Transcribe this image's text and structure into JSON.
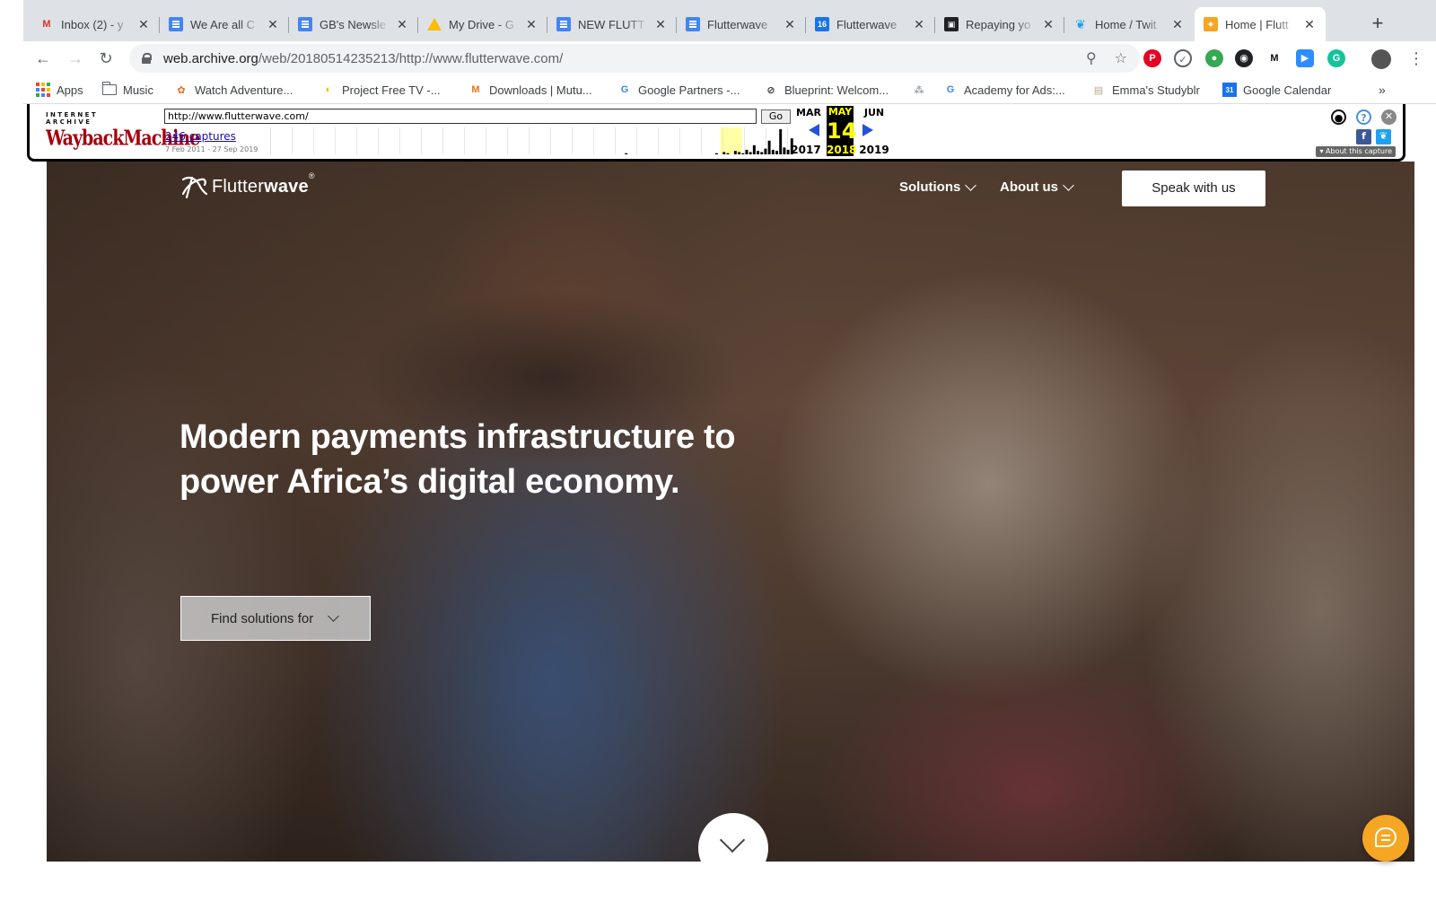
{
  "browser": {
    "tabs": [
      {
        "title": "Inbox (2) - y",
        "icon": "gmail-icon"
      },
      {
        "title": "We Are all C",
        "icon": "docs-icon"
      },
      {
        "title": "GB's Newsle",
        "icon": "docs-icon"
      },
      {
        "title": "My Drive - G",
        "icon": "drive-icon"
      },
      {
        "title": "NEW FLUTT",
        "icon": "docs-icon"
      },
      {
        "title": "Flutterwave",
        "icon": "docs-icon"
      },
      {
        "title": "Flutterwave",
        "icon": "calendar-icon",
        "icon_text": "16"
      },
      {
        "title": "Repaying yo",
        "icon": "page-icon"
      },
      {
        "title": "Home / Twit",
        "icon": "twitter-icon"
      },
      {
        "title": "Home | Flutt",
        "icon": "flutterwave-icon",
        "active": true
      }
    ],
    "url_host": "web.archive.org",
    "url_path": "/web/20180514235213/http://www.flutterwave.com/",
    "bookmarks": [
      "Apps",
      "Music",
      "Watch Adventure...",
      "Project Free TV -...",
      "Downloads | Mutu...",
      "Google Partners -...",
      "Blueprint: Welcom...",
      "Academy for Ads:...",
      "Emma's Studyblr",
      "Google Calendar"
    ],
    "bookmarks_more": "»",
    "new_tab": "+",
    "extension_m": "M"
  },
  "wayback": {
    "logo_top": "INTERNET ARCHIVE",
    "logo_main": "WaybackMachine",
    "url_value": "http://www.flutterwave.com/",
    "go_label": "Go",
    "captures": "246 captures",
    "range": "7 Feb 2011 - 27 Sep 2019",
    "prev_month": "MAR",
    "current_month": "MAY",
    "next_month": "JUN",
    "day": "14",
    "prev_year": "2017",
    "current_year": "2018",
    "next_year": "2019",
    "about": "About this capture",
    "sparkline": [
      0,
      0,
      0,
      0,
      0,
      0,
      0,
      0,
      0,
      0,
      0,
      0,
      0,
      0,
      0,
      0,
      0,
      0,
      0,
      0,
      0,
      0,
      0,
      0,
      0,
      0,
      0,
      0,
      0,
      0,
      0,
      0,
      0,
      0,
      0,
      0,
      0,
      0,
      0,
      0,
      0,
      0,
      0,
      0,
      0,
      0,
      0,
      0,
      0,
      0,
      0,
      0,
      0,
      0,
      0,
      0,
      0,
      0,
      0,
      0,
      0,
      0,
      0,
      0,
      0,
      0,
      0,
      0,
      0,
      0,
      0,
      0,
      0,
      0,
      0,
      0,
      0,
      0,
      0,
      0,
      0,
      0,
      0,
      0,
      0,
      0,
      0,
      0,
      0,
      0,
      0,
      0,
      0,
      0,
      1,
      0,
      0,
      0,
      0,
      0,
      0,
      0,
      0,
      0,
      0,
      0,
      0,
      0,
      0,
      0,
      0,
      0,
      0,
      0,
      0,
      0,
      0,
      0,
      1,
      0,
      2,
      1,
      0,
      3,
      2,
      1,
      4,
      2,
      8,
      3,
      2,
      5,
      12,
      4,
      3,
      22,
      6,
      4,
      14
    ]
  },
  "site": {
    "brand_light": "Flutter",
    "brand_bold": "wave",
    "brand_reg": "®",
    "nav": {
      "solutions": "Solutions",
      "about": "About us",
      "speak": "Speak with us"
    },
    "headline": "Modern payments infrastructure to power Africa’s digital economy.",
    "find_solutions": "Find solutions for"
  },
  "colors": {
    "accent": "#f5a623",
    "wayback_red": "#a5000c",
    "wayback_highlight": "#ffff00",
    "chrome_tabstrip": "#dee1e6"
  }
}
